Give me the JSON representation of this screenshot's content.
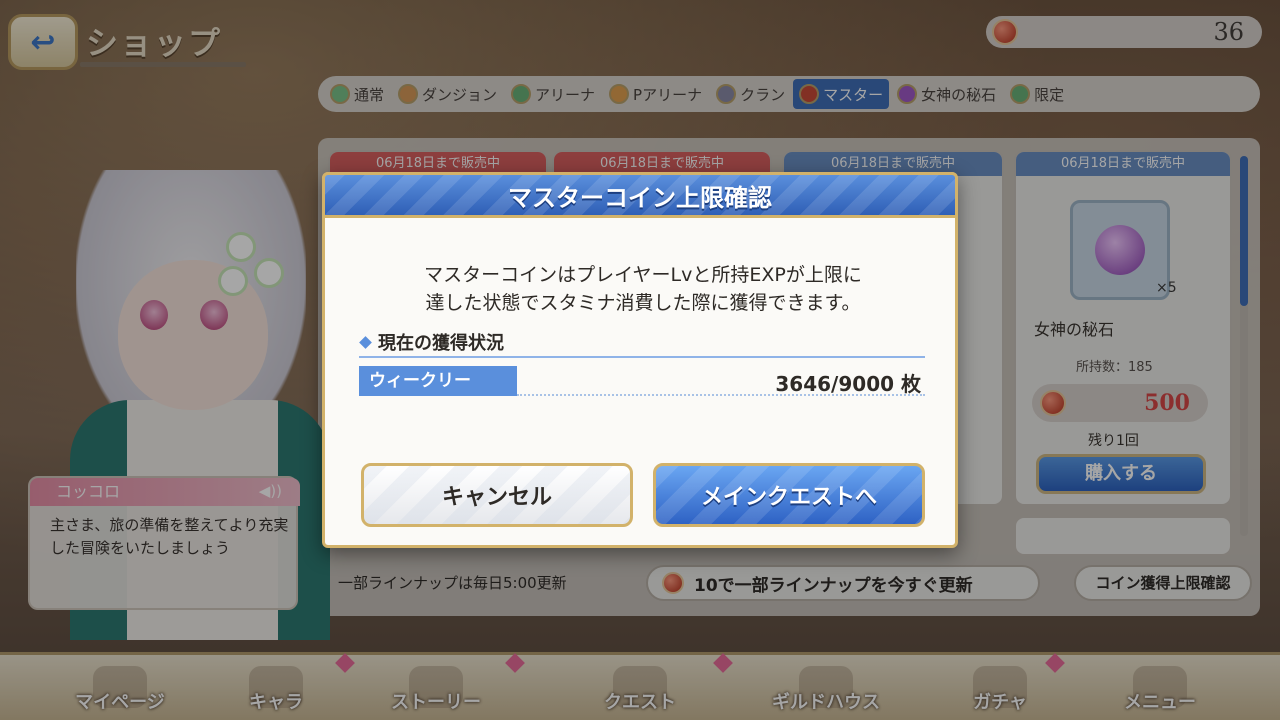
{
  "header": {
    "title": "ショップ",
    "coin_count": "36"
  },
  "tabs": [
    {
      "label": "通常",
      "active": false
    },
    {
      "label": "ダンジョン",
      "active": false
    },
    {
      "label": "アリーナ",
      "active": false
    },
    {
      "label": "Pアリーナ",
      "active": false
    },
    {
      "label": "クラン",
      "active": false
    },
    {
      "label": "マスター",
      "active": true
    },
    {
      "label": "女神の秘石",
      "active": false
    },
    {
      "label": "限定",
      "active": false
    }
  ],
  "shop": {
    "card_header": "06月18日まで販売中",
    "item_name": "女神の秘石",
    "item_qty": "×5",
    "owned": "所持数：185",
    "price": "500",
    "remaining": "残り1回",
    "buy_label": "購入する",
    "footer_note": "一部ラインナップは毎日5:00更新",
    "refresh_label": "10で一部ラインナップを今すぐ更新",
    "cap_label": "コイン獲得上限確認"
  },
  "character": {
    "name": "コッコロ",
    "speech": "主さま、旅の準備を整えてより充実した冒険をいたしましょう"
  },
  "bottom_nav": [
    {
      "label": "マイページ"
    },
    {
      "label": "キャラ"
    },
    {
      "label": "ストーリー"
    },
    {
      "label": "クエスト"
    },
    {
      "label": "ギルドハウス"
    },
    {
      "label": "ガチャ"
    },
    {
      "label": "メニュー"
    }
  ],
  "modal": {
    "title": "マスターコイン上限確認",
    "desc_line1": "マスターコインはプレイヤーLvと所持EXPが上限に",
    "desc_line2": "達した状態でスタミナ消費した際に獲得できます。",
    "section_label": "現在の獲得状況",
    "weekly_label": "ウィークリー",
    "weekly_value": "3646/9000 枚",
    "cancel_label": "キャンセル",
    "main_label": "メインクエストへ"
  },
  "colors": {
    "accent_blue": "#3f6fb8",
    "gold_border": "#d2b26a",
    "price_red": "#d84848"
  }
}
